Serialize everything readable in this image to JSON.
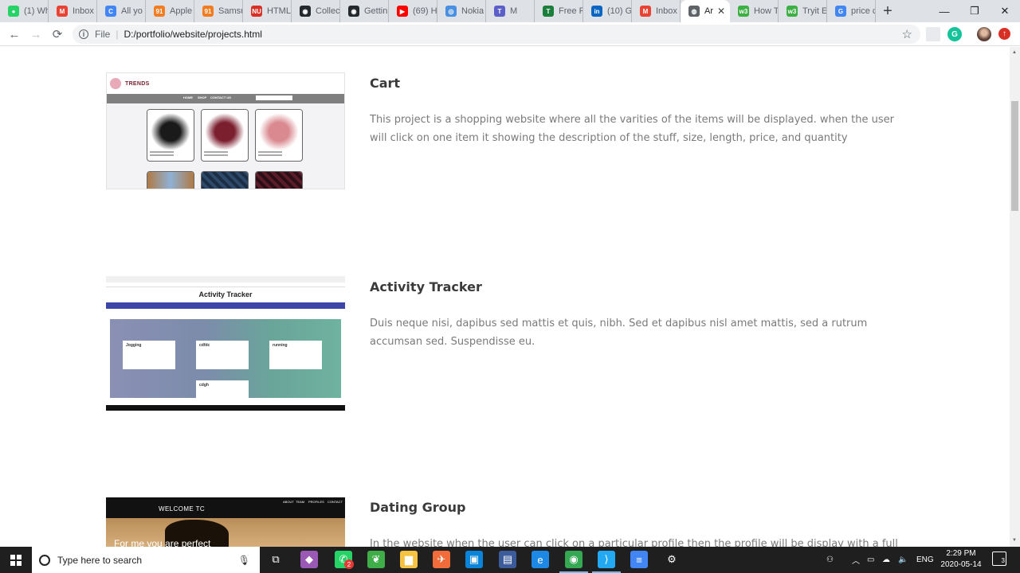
{
  "browser": {
    "tabs": [
      {
        "label": "(1) Wh",
        "color": "#25d366",
        "glyph": "●"
      },
      {
        "label": "Inbox",
        "color": "#ea4335",
        "glyph": "M"
      },
      {
        "label": "All yo",
        "color": "#4285f4",
        "glyph": "C"
      },
      {
        "label": "Apple",
        "color": "#f47c20",
        "glyph": "91"
      },
      {
        "label": "Samsu",
        "color": "#f47c20",
        "glyph": "91"
      },
      {
        "label": "HTML",
        "color": "#d93025",
        "glyph": "NU"
      },
      {
        "label": "Collec",
        "color": "#24292e",
        "glyph": "◉"
      },
      {
        "label": "Gettin",
        "color": "#24292e",
        "glyph": "◉"
      },
      {
        "label": "(69) H",
        "color": "#ff0000",
        "glyph": "▶"
      },
      {
        "label": "Nokia",
        "color": "#4a90e2",
        "glyph": "◎"
      },
      {
        "label": "M",
        "color": "#5b5fc7",
        "glyph": "T"
      },
      {
        "label": "Free R",
        "color": "#1b7f3b",
        "glyph": "T"
      },
      {
        "label": "(10) G",
        "color": "#0a66c2",
        "glyph": "in"
      },
      {
        "label": "Inbox",
        "color": "#ea4335",
        "glyph": "M"
      },
      {
        "label": "Ar",
        "color": "#5f6368",
        "glyph": "◍",
        "active": true
      },
      {
        "label": "How T",
        "color": "#3cb043",
        "glyph": "w3"
      },
      {
        "label": "Tryit E",
        "color": "#3cb043",
        "glyph": "w3"
      },
      {
        "label": "price c",
        "color": "#4285f4",
        "glyph": "G"
      }
    ],
    "new_tab_glyph": "+",
    "window_controls": {
      "minimize": "—",
      "maximize": "❐",
      "close": "✕"
    },
    "nav": {
      "back": "←",
      "forward": "→",
      "reload": "⟳"
    },
    "address": {
      "info_glyph": "i",
      "scheme": "File",
      "path": "D:/portfolio/website/projects.html",
      "bookmark_glyph": "☆"
    },
    "extensions": [
      {
        "name": "extension-icon",
        "color": "#e8eaed",
        "glyph": ""
      },
      {
        "name": "grammarly-icon",
        "color": "#15c39a",
        "glyph": "G"
      },
      {
        "name": "profile-avatar",
        "color": "#6d4c41",
        "glyph": ""
      },
      {
        "name": "update-icon",
        "color": "#d93025",
        "glyph": "↑"
      }
    ]
  },
  "projects": [
    {
      "title": "Cart",
      "description": "This project is a shopping website where all the varities of the items will be displayed. when the user will click on one item it showing the description of the stuff, size, length, price, and quantity",
      "thumb": {
        "logo": "TRENDS",
        "nav": [
          "HOME",
          "SHOP",
          "CONTACT US"
        ]
      }
    },
    {
      "title": "Activity Tracker",
      "description": "Duis neque nisi, dapibus sed mattis et quis, nibh. Sed et dapibus nisl amet mattis, sed a rutrum accumsan sed. Suspendisse eu.",
      "thumb": {
        "heading": "Activity Tracker",
        "cards": [
          "Jogging",
          "cdfdc",
          "running",
          "cdgh"
        ]
      }
    },
    {
      "title": "Dating Group",
      "description": "In the website when the user can click on a particular profile then the profile will be display with a full",
      "thumb": {
        "welcome": "WELCOME TC",
        "slogan": "For me you are perfect",
        "menu": [
          "ABOUT",
          "TEAM",
          "PROFILES",
          "CONTACT"
        ]
      }
    }
  ],
  "taskbar": {
    "search_placeholder": "Type here to search",
    "apps": [
      {
        "name": "task-view-icon",
        "glyph": "⧉",
        "color": "transparent"
      },
      {
        "name": "git-icon",
        "glyph": "◆",
        "color": "#9b59b6"
      },
      {
        "name": "whatsapp-icon",
        "glyph": "✆",
        "color": "#25d366",
        "badge": "2"
      },
      {
        "name": "leaf-app-icon",
        "glyph": "❦",
        "color": "#3fae49"
      },
      {
        "name": "file-explorer-icon",
        "glyph": "▆",
        "color": "#f5c242"
      },
      {
        "name": "postman-icon",
        "glyph": "✈",
        "color": "#f26b3a"
      },
      {
        "name": "store-icon",
        "glyph": "▣",
        "color": "#0a84d8"
      },
      {
        "name": "app-icon",
        "glyph": "▤",
        "color": "#3b5b9a"
      },
      {
        "name": "edge-icon",
        "glyph": "e",
        "color": "#1e88e5"
      },
      {
        "name": "chrome-icon",
        "glyph": "◉",
        "color": "#34a853",
        "running": true
      },
      {
        "name": "vscode-icon",
        "glyph": "⟩",
        "color": "#23a9f2",
        "running": true
      },
      {
        "name": "docs-icon",
        "glyph": "≡",
        "color": "#4285f4"
      },
      {
        "name": "settings-icon",
        "glyph": "⚙",
        "color": "transparent"
      }
    ],
    "tray": {
      "language": "ENG",
      "time": "2:29 PM",
      "date": "2020-05-14",
      "notifications": "3"
    }
  }
}
